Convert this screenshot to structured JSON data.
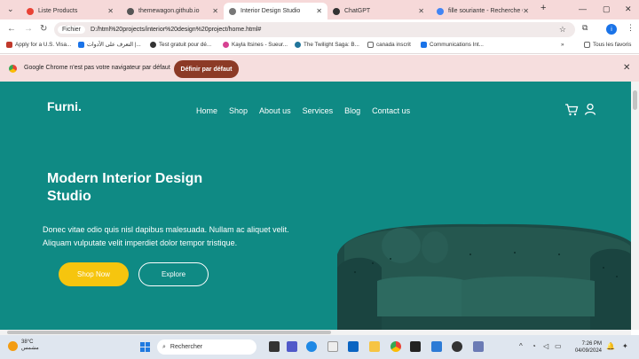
{
  "browser": {
    "tabs": [
      {
        "title": "Liste Products",
        "color": "#e94235",
        "active": false
      },
      {
        "title": "themewagon.github.io",
        "color": "#555555",
        "active": false
      },
      {
        "title": "Interior Design Studio",
        "color": "#777777",
        "active": true
      },
      {
        "title": "ChatGPT",
        "color": "#333333",
        "active": false
      },
      {
        "title": "fille souriante - Recherche G",
        "color": "#4285f4",
        "active": false
      }
    ],
    "url_chip": "Fichier",
    "url": "D:/html%20projects/interior%20design%20project/home.html#",
    "profile_initial": "i",
    "bookmarks": [
      {
        "label": "Apply for a U.S. Visa...",
        "color": "#c0392b"
      },
      {
        "label": "التعرف على الأدوات |...",
        "color": "#1a73e8"
      },
      {
        "label": "Test gratuit pour dé...",
        "color": "#333333"
      },
      {
        "label": "Kayla Itsines - Sueur...",
        "color": "#d64292"
      },
      {
        "label": "The Twilight Saga: B...",
        "color": "#21759b"
      },
      {
        "label": "canada inscrit",
        "color": "#888888"
      },
      {
        "label": "Communications Int...",
        "color": "#1a73e8"
      }
    ],
    "all_bookmarks": "Tous les favoris",
    "infobar": {
      "message": "Google Chrome n'est pas votre navigateur par défaut",
      "button": "Définir par défaut"
    }
  },
  "site": {
    "brand": "Furni.",
    "nav": [
      "Home",
      "Shop",
      "About us",
      "Services",
      "Blog",
      "Contact us"
    ],
    "hero_title": "Modern Interior Design Studio",
    "hero_text": "Donec vitae odio quis nisl dapibus malesuada. Nullam ac aliquet velit. Aliquam vulputate velit imperdiet dolor tempor tristique.",
    "shop_button": "Shop Now",
    "explore_button": "Explore",
    "colors": {
      "background": "#0f8a84",
      "accent": "#f6c50e"
    }
  },
  "taskbar": {
    "temperature": "38°C",
    "weather": "مشمس",
    "search_placeholder": "Rechercher",
    "time": "7:26 PM",
    "date": "04/09/2024"
  }
}
